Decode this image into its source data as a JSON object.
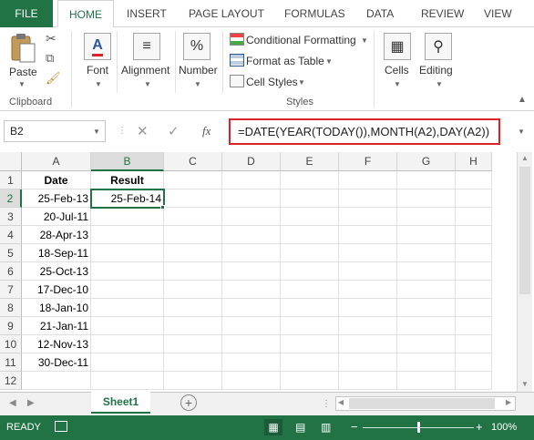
{
  "tabs": {
    "file": "FILE",
    "home": "HOME",
    "insert": "INSERT",
    "page_layout": "PAGE LAYOUT",
    "formulas": "FORMULAS",
    "data": "DATA",
    "review": "REVIEW",
    "view": "VIEW"
  },
  "ribbon": {
    "paste": "Paste",
    "clipboard": "Clipboard",
    "font": "Font",
    "alignment": "Alignment",
    "number": "Number",
    "percent": "%",
    "conditional_formatting": "Conditional Formatting",
    "format_as_table": "Format as Table",
    "cell_styles": "Cell Styles",
    "styles": "Styles",
    "cells": "Cells",
    "editing": "Editing"
  },
  "formula_bar": {
    "name_box": "B2",
    "fx": "fx",
    "formula": "=DATE(YEAR(TODAY()),MONTH(A2),DAY(A2))"
  },
  "grid": {
    "columns": [
      "A",
      "B",
      "C",
      "D",
      "E",
      "F",
      "G",
      "H"
    ],
    "rows": [
      "1",
      "2",
      "3",
      "4",
      "5",
      "6",
      "7",
      "8",
      "9",
      "10",
      "11",
      "12"
    ],
    "header_a": "Date",
    "header_b": "Result",
    "dates": [
      "25-Feb-13",
      "20-Jul-11",
      "28-Apr-13",
      "18-Sep-11",
      "25-Oct-13",
      "17-Dec-10",
      "18-Jan-10",
      "21-Jan-11",
      "12-Nov-13",
      "30-Dec-11"
    ],
    "result_b2": "25-Feb-14"
  },
  "sheets": {
    "active": "Sheet1"
  },
  "status": {
    "ready": "READY",
    "zoom": "100%"
  },
  "colors": {
    "accent": "#217346",
    "highlight_border": "#d9232a"
  }
}
